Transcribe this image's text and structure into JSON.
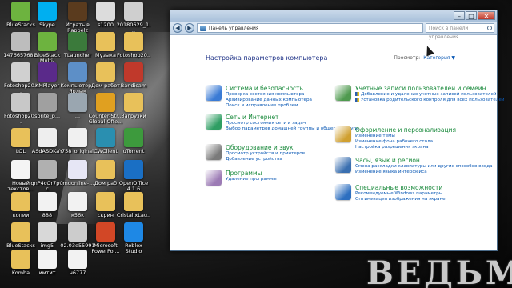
{
  "desktop": {
    "icons": [
      {
        "label": "BlueStacks",
        "glyph": "bluestacks-icon",
        "color": "#6db33f"
      },
      {
        "label": "Skype",
        "glyph": "skype-icon",
        "color": "#00aff0"
      },
      {
        "label": "Играть в Rappelz",
        "glyph": "game-icon",
        "color": "#5a3b1e"
      },
      {
        "label": "s1200",
        "glyph": "image-file-icon",
        "color": "#dcdcdc"
      },
      {
        "label": "20180629_1...",
        "glyph": "image-file-icon",
        "color": "#cfcfcf"
      },
      {
        "label": "1476657689...",
        "glyph": "image-file-icon",
        "color": "#bdbdbd"
      },
      {
        "label": "BlueStack Multi-Instan...",
        "glyph": "bluestacks-icon",
        "color": "#6db33f"
      },
      {
        "label": "TLauncher",
        "glyph": "tlauncher-icon",
        "color": "#3b7a3b"
      },
      {
        "label": "Музыка",
        "glyph": "folder-icon",
        "color": "#e8c15a"
      },
      {
        "label": "Fotoshop20...",
        "glyph": "folder-icon",
        "color": "#e8c15a"
      },
      {
        "label": "Fotoshop20...",
        "glyph": "image-file-icon",
        "color": "#d0d0d0"
      },
      {
        "label": "KMPlayer",
        "glyph": "kmplayer-icon",
        "color": "#5a2a8a"
      },
      {
        "label": "Компьютер - Ярлык",
        "glyph": "computer-icon",
        "color": "#5d8fc7"
      },
      {
        "label": "Дом работ",
        "glyph": "folder-icon",
        "color": "#e8c15a"
      },
      {
        "label": "Bandicam",
        "glyph": "bandicam-icon",
        "color": "#c0392b"
      },
      {
        "label": "Fotoshop20...",
        "glyph": "image-file-icon",
        "color": "#c8c8c8"
      },
      {
        "label": "sprite_p...",
        "glyph": "image-file-icon",
        "color": "#a0a0a0"
      },
      {
        "label": "...",
        "glyph": "image-file-icon",
        "color": "#9aa6b0"
      },
      {
        "label": "Counter-Str... Global Offe...",
        "glyph": "csgo-icon",
        "color": "#e0a020"
      },
      {
        "label": "Загрузки",
        "glyph": "folder-icon",
        "color": "#e8c15a"
      },
      {
        "label": "LOL",
        "glyph": "folder-icon",
        "color": "#e8c15a"
      },
      {
        "label": "ASdASDKaY",
        "glyph": "text-file-icon",
        "color": "#eeeeee"
      },
      {
        "label": "758_original",
        "glyph": "image-file-icon",
        "color": "#f0f0f0"
      },
      {
        "label": "CWClient",
        "glyph": "cwclient-icon",
        "color": "#2a8fb0"
      },
      {
        "label": "uTorrent",
        "glyph": "utorrent-icon",
        "color": "#3d9a3d"
      },
      {
        "label": "Новый текстов...",
        "glyph": "text-file-icon",
        "color": "#f4f4f4"
      },
      {
        "label": "qnP4cOr7pQc",
        "glyph": "image-file-icon",
        "color": "#b0b0b0"
      },
      {
        "label": "imgonline-...",
        "glyph": "image-file-icon",
        "color": "#e6e6f5"
      },
      {
        "label": "Дом раб",
        "glyph": "folder-icon",
        "color": "#e8c15a"
      },
      {
        "label": "OpenOffice 4.1.6",
        "glyph": "openoffice-icon",
        "color": "#1a6fc4"
      },
      {
        "label": "копии",
        "glyph": "folder-icon",
        "color": "#e8c15a"
      },
      {
        "label": "888",
        "glyph": "text-file-icon",
        "color": "#f2f2f2"
      },
      {
        "label": "к56к",
        "glyph": "text-file-icon",
        "color": "#f2f2f2"
      },
      {
        "label": "скрин",
        "glyph": "folder-icon",
        "color": "#e8c15a"
      },
      {
        "label": "CristalixLau...",
        "glyph": "folder-icon",
        "color": "#e8c15a"
      },
      {
        "label": "BlueStacks",
        "glyph": "folder-icon",
        "color": "#e8c15a"
      },
      {
        "label": "img5",
        "glyph": "image-file-icon",
        "color": "#d8d8d8"
      },
      {
        "label": "02.03e55991",
        "glyph": "image-file-icon",
        "color": "#cccccc"
      },
      {
        "label": "Microsoft PowerPoi...",
        "glyph": "powerpoint-icon",
        "color": "#d24726"
      },
      {
        "label": "Roblox Studio",
        "glyph": "roblox-studio-icon",
        "color": "#1e88e5"
      },
      {
        "label": "Komba",
        "glyph": "folder-icon",
        "color": "#e8c15a"
      },
      {
        "label": "имтит",
        "glyph": "text-file-icon",
        "color": "#f2f2f2"
      },
      {
        "label": "н6777",
        "glyph": "text-file-icon",
        "color": "#f2f2f2"
      }
    ],
    "wallpaper_text": "ВЕДЬМ"
  },
  "window": {
    "address": "Панель управления",
    "search_placeholder": "Поиск в панели управления",
    "heading": "Настройка параметров компьютера",
    "view_by_label": "Просмотр:",
    "view_by_value": "Категория ▼",
    "categories": [
      {
        "title": "Система и безопасность",
        "icon": "system-security-icon",
        "color": "#3a7bd5",
        "links": [
          {
            "text": "Проверка состояния компьютера",
            "shield": false
          },
          {
            "text": "Архивирование данных компьютера",
            "shield": false
          },
          {
            "text": "Поиск и исправление проблем",
            "shield": false
          }
        ]
      },
      {
        "title": "Сеть и Интернет",
        "icon": "network-icon",
        "color": "#2f9e63",
        "links": [
          {
            "text": "Просмотр состояния сети и задач",
            "shield": false
          },
          {
            "text": "Выбор параметров домашней группы и общего доступа",
            "shield": false
          }
        ]
      },
      {
        "title": "Оборудование и звук",
        "icon": "hardware-sound-icon",
        "color": "#7a7a7a",
        "links": [
          {
            "text": "Просмотр устройств и принтеров",
            "shield": false
          },
          {
            "text": "Добавление устройства",
            "shield": false
          }
        ]
      },
      {
        "title": "Программы",
        "icon": "programs-icon",
        "color": "#9c7bb5",
        "links": [
          {
            "text": "Удаление программы",
            "shield": false
          }
        ]
      },
      {
        "title": "Учетные записи пользователей и семейн...",
        "icon": "user-accounts-icon",
        "color": "#4f9a4f",
        "links": [
          {
            "text": "Добавление и удаление учетных записей пользователей",
            "shield": true
          },
          {
            "text": "Установка родительского контроля для всех пользователей",
            "shield": true
          }
        ]
      },
      {
        "title": "Оформление и персонализация",
        "icon": "appearance-icon",
        "color": "#d0a030",
        "links": [
          {
            "text": "Изменение темы",
            "shield": false
          },
          {
            "text": "Изменение фона рабочего стола",
            "shield": false
          },
          {
            "text": "Настройка разрешения экрана",
            "shield": false
          }
        ]
      },
      {
        "title": "Часы, язык и регион",
        "icon": "clock-language-icon",
        "color": "#3a6fb0",
        "links": [
          {
            "text": "Смена раскладки клавиатуры или других способов ввода",
            "shield": false
          },
          {
            "text": "Изменение языка интерфейса",
            "shield": false
          }
        ]
      },
      {
        "title": "Специальные возможности",
        "icon": "accessibility-icon",
        "color": "#2d6fc0",
        "links": [
          {
            "text": "Рекомендуемые Windows параметры",
            "shield": false
          },
          {
            "text": "Оптимизация изображения на экране",
            "shield": false
          }
        ]
      }
    ]
  }
}
